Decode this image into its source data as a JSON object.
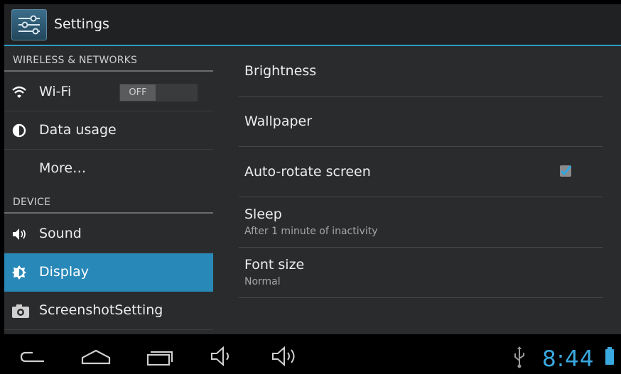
{
  "actionbar": {
    "title": "Settings",
    "icon": "settings-sliders-icon"
  },
  "sidebar": {
    "categories": [
      "WIRELESS & NETWORKS",
      "DEVICE"
    ],
    "items": [
      {
        "label": "Wi-Fi",
        "icon": "wifi-icon",
        "toggle": "OFF"
      },
      {
        "label": "Data usage",
        "icon": "data-usage-icon"
      },
      {
        "label": "More…",
        "icon": ""
      },
      {
        "label": "Sound",
        "icon": "speaker-icon"
      },
      {
        "label": "Display",
        "icon": "brightness-icon",
        "selected": true
      },
      {
        "label": "ScreenshotSetting",
        "icon": "camera-icon"
      }
    ]
  },
  "display": {
    "rows": [
      {
        "title": "Brightness"
      },
      {
        "title": "Wallpaper"
      },
      {
        "title": "Auto-rotate screen",
        "checked": true
      },
      {
        "title": "Sleep",
        "summary": "After 1 minute of inactivity"
      },
      {
        "title": "Font size",
        "summary": "Normal"
      }
    ]
  },
  "statusbar": {
    "time": "8:44",
    "accent": "#3aa9e0"
  },
  "colors": {
    "selected": "#2888b8",
    "divider": "#2d9cc4",
    "background": "#2a2b2d"
  }
}
